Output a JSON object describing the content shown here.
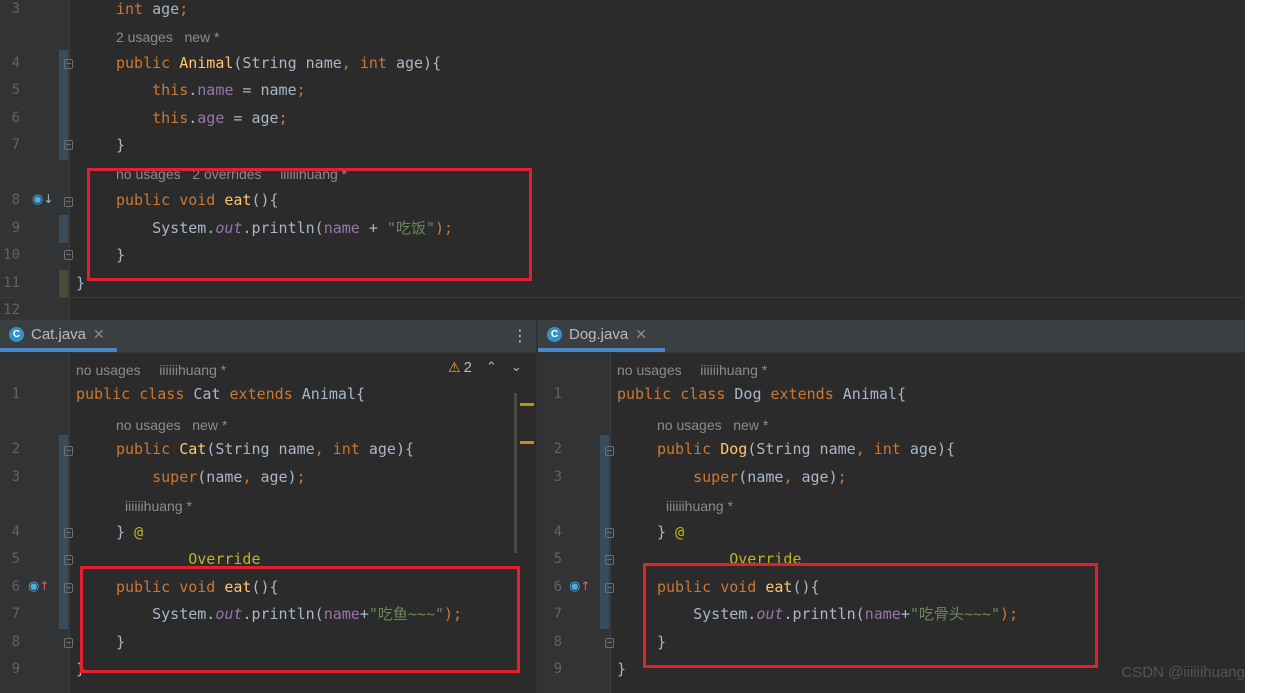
{
  "top_editor": {
    "lines": [
      {
        "num": "3",
        "tokens": [
          {
            "t": "int ",
            "c": "kw"
          },
          {
            "t": "age",
            "c": "plain"
          },
          {
            "t": ";",
            "c": "kw"
          }
        ]
      },
      {
        "hint": "2 usages   new *"
      },
      {
        "num": "4",
        "tokens": [
          {
            "t": "public ",
            "c": "kw"
          },
          {
            "t": "Animal",
            "c": "fn"
          },
          {
            "t": "(String name",
            "c": "plain"
          },
          {
            "t": ", ",
            "c": "kw"
          },
          {
            "t": "int ",
            "c": "kw"
          },
          {
            "t": "age){",
            "c": "plain"
          }
        ]
      },
      {
        "num": "5",
        "tokens": [
          {
            "t": "    this",
            "c": "kw"
          },
          {
            "t": ".",
            "c": "plain"
          },
          {
            "t": "name",
            "c": "fld"
          },
          {
            "t": " = name",
            "c": "plain"
          },
          {
            "t": ";",
            "c": "kw"
          }
        ]
      },
      {
        "num": "6",
        "tokens": [
          {
            "t": "    this",
            "c": "kw"
          },
          {
            "t": ".",
            "c": "plain"
          },
          {
            "t": "age",
            "c": "fld"
          },
          {
            "t": " = age",
            "c": "plain"
          },
          {
            "t": ";",
            "c": "kw"
          }
        ]
      },
      {
        "num": "7",
        "tokens": [
          {
            "t": "}",
            "c": "plain"
          }
        ]
      },
      {
        "hint": "no usages   2 overrides    iiiiiihuang *"
      },
      {
        "num": "8",
        "tokens": [
          {
            "t": "public ",
            "c": "kw"
          },
          {
            "t": "void ",
            "c": "kw"
          },
          {
            "t": "eat",
            "c": "fn"
          },
          {
            "t": "(){",
            "c": "plain"
          }
        ]
      },
      {
        "num": "9",
        "tokens": [
          {
            "t": "    System.",
            "c": "plain"
          },
          {
            "t": "out",
            "c": "it"
          },
          {
            "t": ".println(",
            "c": "plain"
          },
          {
            "t": "name",
            "c": "fld"
          },
          {
            "t": " + ",
            "c": "plain"
          },
          {
            "t": "\"吃饭\"",
            "c": "str"
          },
          {
            "t": ");",
            "c": "kw"
          }
        ]
      },
      {
        "num": "10",
        "tokens": [
          {
            "t": "}",
            "c": "plain"
          }
        ]
      },
      {
        "num": "11",
        "tokens": [
          {
            "t": "}",
            "c": "plain"
          }
        ]
      },
      {
        "num": "12",
        "tokens": []
      }
    ]
  },
  "cat_editor": {
    "tab": {
      "icon": "C",
      "label": "Cat.java",
      "close": "✕"
    },
    "warning_count": "2",
    "lines": [
      {
        "hint": "no usages    iiiiiihuang *"
      },
      {
        "num": "1",
        "tokens": [
          {
            "t": "public ",
            "c": "kw"
          },
          {
            "t": "class ",
            "c": "kw"
          },
          {
            "t": "Cat ",
            "c": "plain"
          },
          {
            "t": "extends ",
            "c": "kw"
          },
          {
            "t": "Animal{",
            "c": "plain"
          }
        ]
      },
      {
        "hint": "no usages   new *"
      },
      {
        "num": "2",
        "tokens": [
          {
            "t": "public ",
            "c": "kw"
          },
          {
            "t": "Cat",
            "c": "fn"
          },
          {
            "t": "(String name",
            "c": "plain"
          },
          {
            "t": ", ",
            "c": "kw"
          },
          {
            "t": "int ",
            "c": "kw"
          },
          {
            "t": "age){",
            "c": "plain"
          }
        ]
      },
      {
        "num": "3",
        "tokens": [
          {
            "t": "    super",
            "c": "kw"
          },
          {
            "t": "(name",
            "c": "plain"
          },
          {
            "t": ", ",
            "c": "kw"
          },
          {
            "t": "age)",
            "c": "plain"
          },
          {
            "t": ";",
            "c": "kw"
          }
        ]
      },
      {
        "hint": " iiiiiihuang *"
      },
      {
        "num": "4",
        "tokens": [
          {
            "t": "} ",
            "c": "plain"
          },
          {
            "t": "@",
            "c": "ann"
          }
        ]
      },
      {
        "num": "5",
        "tokens": [
          {
            "t": "        Override",
            "c": "ann"
          }
        ]
      },
      {
        "num": "6",
        "tokens": [
          {
            "t": "public ",
            "c": "kw"
          },
          {
            "t": "void ",
            "c": "kw"
          },
          {
            "t": "eat",
            "c": "fn"
          },
          {
            "t": "(){",
            "c": "plain"
          }
        ]
      },
      {
        "num": "7",
        "tokens": [
          {
            "t": "    System.",
            "c": "plain"
          },
          {
            "t": "out",
            "c": "it"
          },
          {
            "t": ".println(",
            "c": "plain"
          },
          {
            "t": "name",
            "c": "fld"
          },
          {
            "t": "+",
            "c": "plain"
          },
          {
            "t": "\"吃鱼~~~\"",
            "c": "str"
          },
          {
            "t": ");",
            "c": "kw"
          }
        ]
      },
      {
        "num": "8",
        "tokens": [
          {
            "t": "}",
            "c": "plain"
          }
        ]
      },
      {
        "num": "9",
        "tokens": [
          {
            "t": "}",
            "c": "plain"
          }
        ]
      }
    ]
  },
  "dog_editor": {
    "tab": {
      "icon": "C",
      "label": "Dog.java",
      "close": "✕"
    },
    "lines": [
      {
        "hint": "no usages    iiiiiihuang *"
      },
      {
        "num": "1",
        "tokens": [
          {
            "t": "public ",
            "c": "kw"
          },
          {
            "t": "class ",
            "c": "kw"
          },
          {
            "t": "Dog ",
            "c": "plain"
          },
          {
            "t": "extends ",
            "c": "kw"
          },
          {
            "t": "Animal{",
            "c": "plain"
          }
        ]
      },
      {
        "hint": "no usages   new *"
      },
      {
        "num": "2",
        "tokens": [
          {
            "t": "public ",
            "c": "kw"
          },
          {
            "t": "Dog",
            "c": "fn"
          },
          {
            "t": "(String name",
            "c": "plain"
          },
          {
            "t": ", ",
            "c": "kw"
          },
          {
            "t": "int ",
            "c": "kw"
          },
          {
            "t": "age){",
            "c": "plain"
          }
        ]
      },
      {
        "num": "3",
        "tokens": [
          {
            "t": "    super",
            "c": "kw"
          },
          {
            "t": "(name",
            "c": "plain"
          },
          {
            "t": ", ",
            "c": "kw"
          },
          {
            "t": "age)",
            "c": "plain"
          },
          {
            "t": ";",
            "c": "kw"
          }
        ]
      },
      {
        "hint": " iiiiiihuang *"
      },
      {
        "num": "4",
        "tokens": [
          {
            "t": "} ",
            "c": "plain"
          },
          {
            "t": "@",
            "c": "ann"
          }
        ]
      },
      {
        "num": "5",
        "tokens": [
          {
            "t": "        Override",
            "c": "ann"
          }
        ]
      },
      {
        "num": "6",
        "tokens": [
          {
            "t": "public ",
            "c": "kw"
          },
          {
            "t": "void ",
            "c": "kw"
          },
          {
            "t": "eat",
            "c": "fn"
          },
          {
            "t": "(){",
            "c": "plain"
          }
        ]
      },
      {
        "num": "7",
        "tokens": [
          {
            "t": "    System.",
            "c": "plain"
          },
          {
            "t": "out",
            "c": "it"
          },
          {
            "t": ".println(",
            "c": "plain"
          },
          {
            "t": "name",
            "c": "fld"
          },
          {
            "t": "+",
            "c": "plain"
          },
          {
            "t": "\"吃骨头~~~\"",
            "c": "str"
          },
          {
            "t": ");",
            "c": "kw"
          }
        ]
      },
      {
        "num": "8",
        "tokens": [
          {
            "t": "}",
            "c": "plain"
          }
        ]
      },
      {
        "num": "9",
        "tokens": [
          {
            "t": "}",
            "c": "plain"
          }
        ]
      }
    ]
  },
  "icons": {
    "overridden": "overridden-method-icon",
    "overriding": "overriding-method-icon",
    "warning": "warning-icon",
    "user": "user-icon",
    "more": "more-vertical-icon",
    "prev": "chevron-up-icon",
    "next": "chevron-down-icon"
  },
  "colors": {
    "highlight_box": "#e5202e",
    "editor_bg": "#2b2b2b",
    "keyword": "#cc7832",
    "function": "#ffc66d",
    "string": "#6a8759",
    "field": "#9876aa"
  },
  "watermark": "CSDN @iiiiiihuang"
}
